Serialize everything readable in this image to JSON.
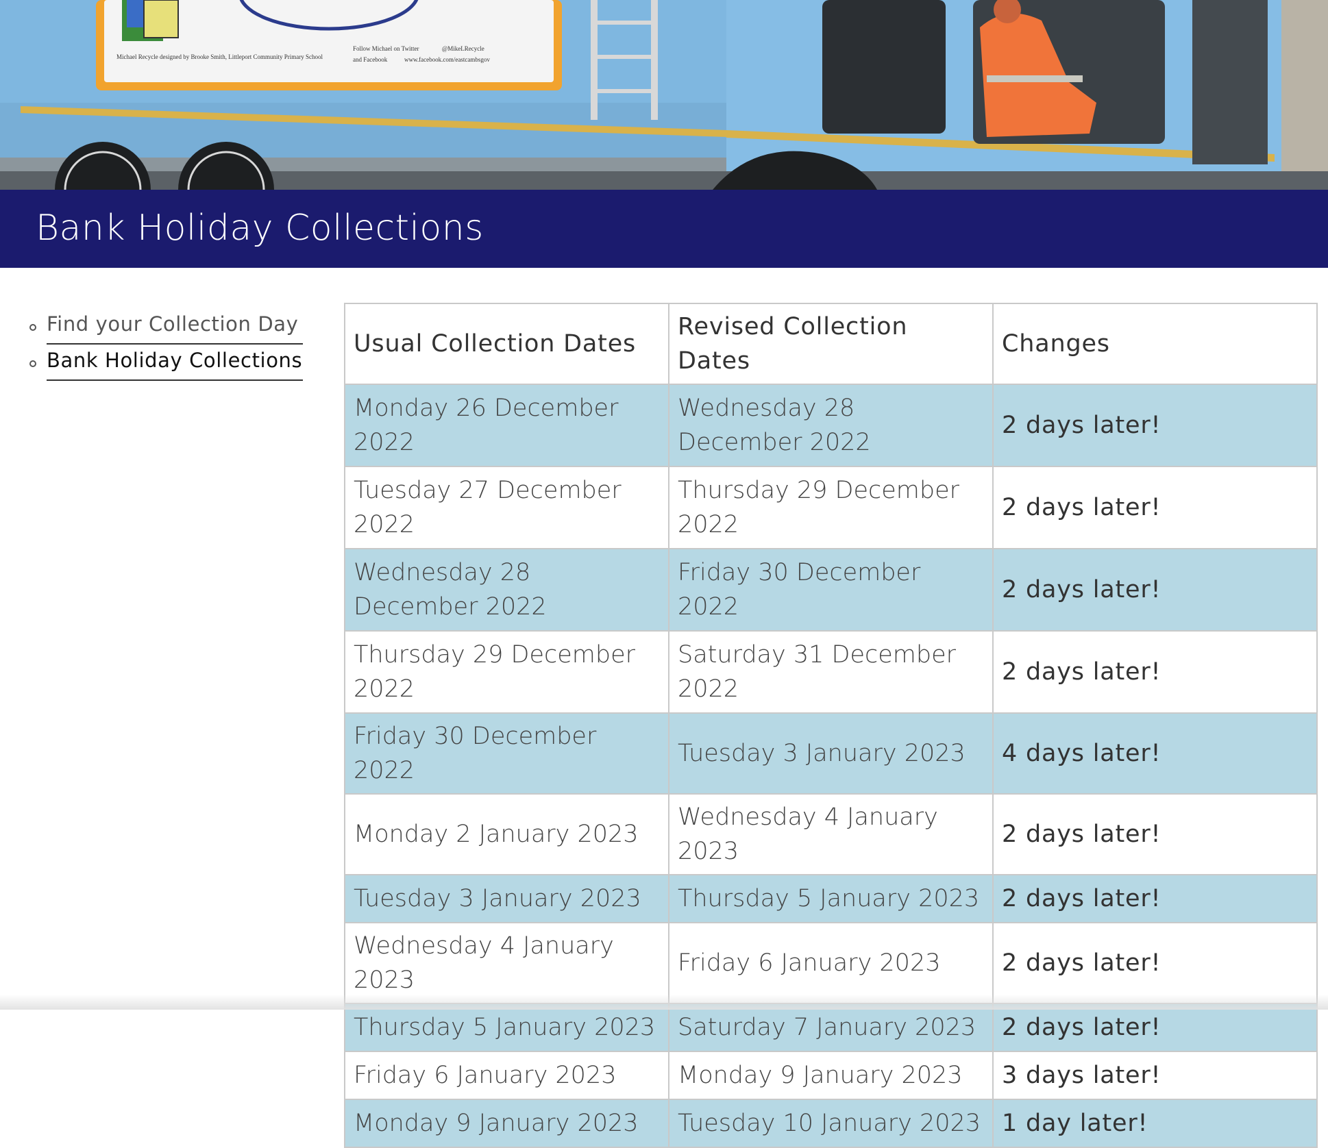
{
  "hero": {
    "alt": "Refuse collection vehicle",
    "sign_caption": "Michael Recycle designed by Brooke Smith, Littleport Community Primary School",
    "sign_follow_line1": "Follow Michael on Twitter",
    "sign_twitter": "@MikeLRecycle",
    "sign_follow_line2": "and Facebook",
    "sign_facebook": "www.facebook.com/eastcambsgov"
  },
  "page": {
    "title": "Bank Holiday Collections"
  },
  "sidebar": {
    "items": [
      {
        "label": "Find your Collection Day"
      },
      {
        "label": "Bank Holiday Collections"
      }
    ]
  },
  "table": {
    "headers": [
      "Usual Collection Dates",
      "Revised Collection Dates",
      "Changes"
    ],
    "rows": [
      {
        "usual": "Monday 26 December 2022",
        "revised": "Wednesday 28 December 2022",
        "change": "2 days later!"
      },
      {
        "usual": "Tuesday 27 December 2022",
        "revised": "Thursday 29 December 2022",
        "change": "2 days later!"
      },
      {
        "usual": "Wednesday 28 December 2022",
        "revised": "Friday 30 December 2022",
        "change": "2 days later!"
      },
      {
        "usual": "Thursday 29 December 2022",
        "revised": "Saturday 31 December 2022",
        "change": "2 days later!"
      },
      {
        "usual": "Friday 30 December 2022",
        "revised": "Tuesday 3 January 2023",
        "change": "4 days later!"
      },
      {
        "usual": "Monday 2 January 2023",
        "revised": "Wednesday 4 January 2023",
        "change": "2 days later!"
      },
      {
        "usual": "Tuesday 3 January 2023",
        "revised": "Thursday 5 January 2023",
        "change": "2 days later!"
      },
      {
        "usual": "Wednesday 4 January 2023",
        "revised": "Friday 6 January 2023",
        "change": "2 days later!"
      },
      {
        "usual": "Thursday 5 January 2023",
        "revised": "Saturday 7 January 2023",
        "change": "2 days later!"
      },
      {
        "usual": "Friday 6 January 2023",
        "revised": "Monday 9 January 2023",
        "change": "3 days later!"
      },
      {
        "usual": "Monday 9 January 2023",
        "revised": "Tuesday 10 January 2023",
        "change": "1 day later!"
      }
    ]
  },
  "colors": {
    "banner": "#1b1b6e",
    "row_stripe": "#b6d8e4",
    "truck_body": "#7fb7e0"
  }
}
